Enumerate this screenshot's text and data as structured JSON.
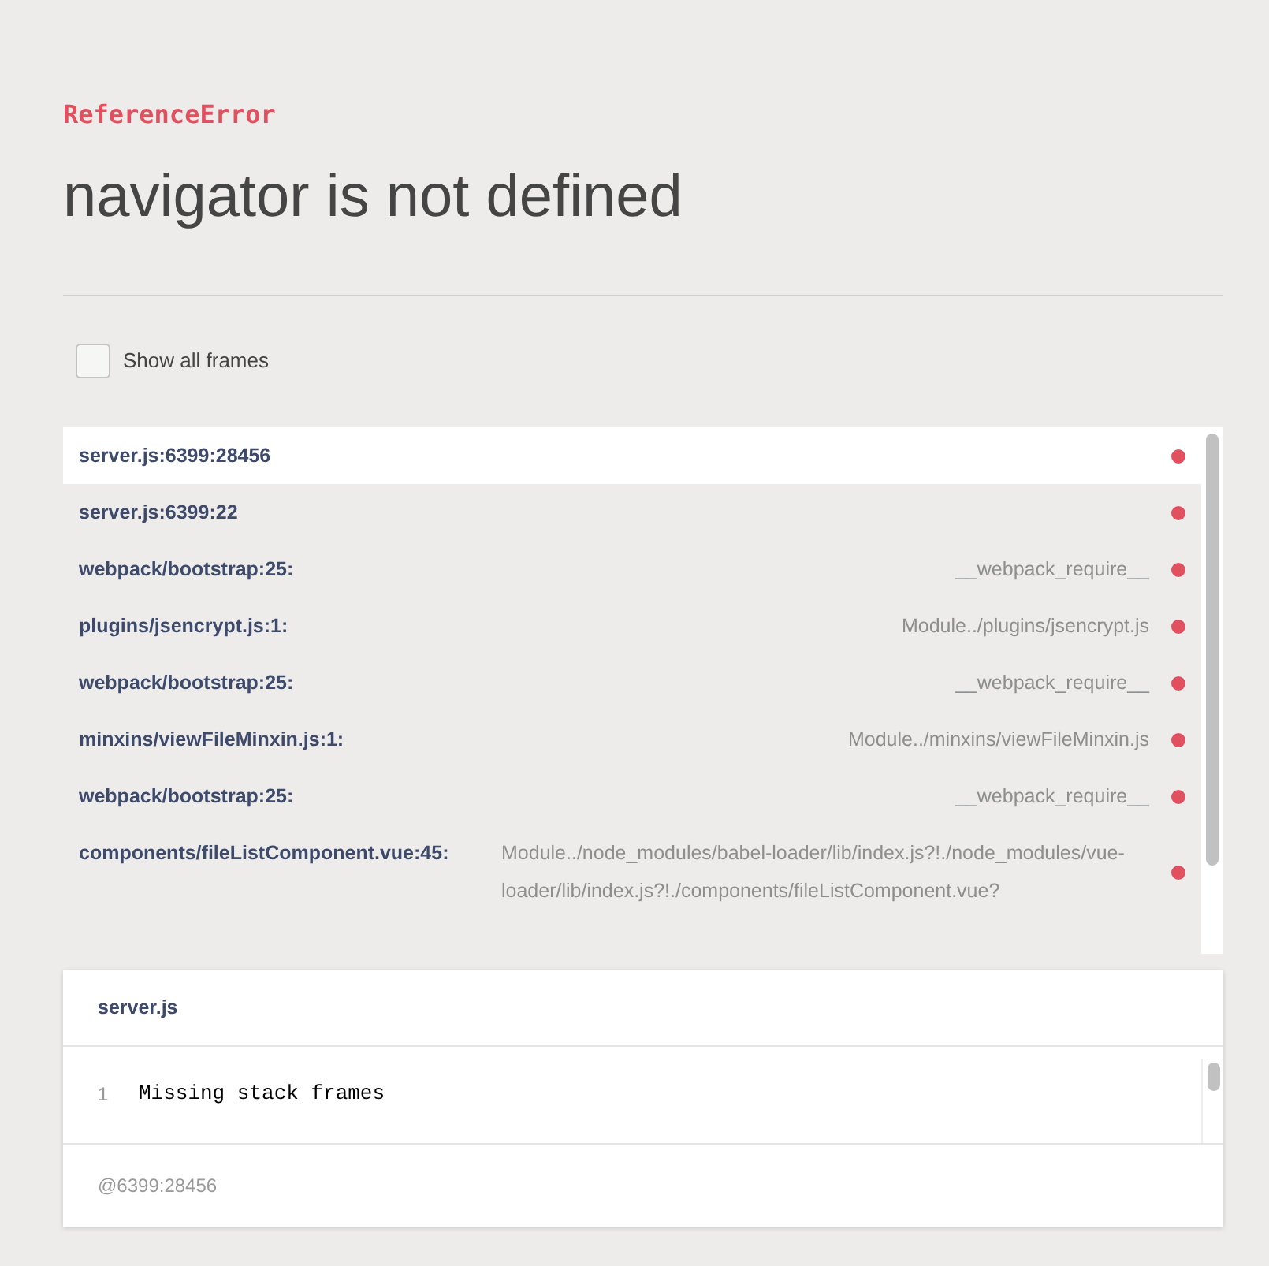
{
  "error": {
    "type": "ReferenceError",
    "message": "navigator is not defined"
  },
  "show_all_frames": {
    "label": "Show all frames",
    "checked": false
  },
  "frames": [
    {
      "file": "server.js:6399:28456",
      "selected": true
    },
    {
      "file": "server.js:6399:22",
      "selected": false
    },
    {
      "file": "webpack/bootstrap:25:",
      "function": "__webpack_require__",
      "selected": false
    },
    {
      "file": "plugins/jsencrypt.js:1:",
      "function": "Module../plugins/jsencrypt.js",
      "selected": false
    },
    {
      "file": "webpack/bootstrap:25:",
      "function": "__webpack_require__",
      "selected": false
    },
    {
      "file": "minxins/viewFileMinxin.js:1:",
      "function": "Module../minxins/viewFileMinxin.js",
      "selected": false
    },
    {
      "file": "webpack/bootstrap:25:",
      "function": "__webpack_require__",
      "selected": false
    },
    {
      "file": "components/fileListComponent.vue:45:",
      "function": "Module../node_modules/babel-loader/lib/index.js?!./node_modules/vue-loader/lib/index.js?!./components/fileListComponent.vue?",
      "selected": false
    }
  ],
  "code": {
    "file": "server.js",
    "lines": [
      {
        "number": "1",
        "text": "Missing stack frames"
      }
    ],
    "location": "@6399:28456"
  }
}
